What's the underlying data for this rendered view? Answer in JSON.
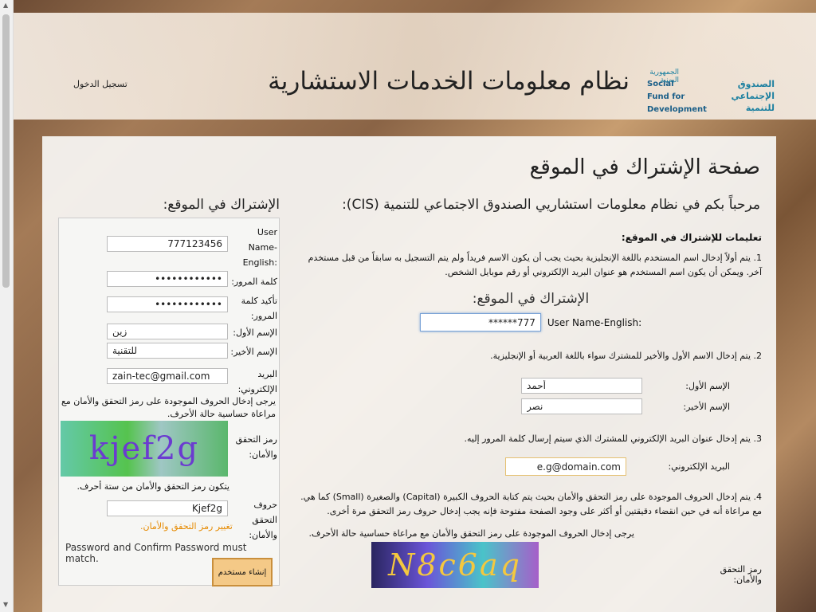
{
  "header": {
    "login_link": "تسجيل الدخول",
    "app_title": "نظام معلومات الخدمات الاستشارية",
    "logo": {
      "emblem_text": "الجمهورية اليمنية",
      "ar_line1": "الصندوق",
      "ar_line2": "الإجتماعي",
      "ar_line3": "للتنمية",
      "en_line1": "Social",
      "en_line2": "Fund for",
      "en_line3": "Development"
    }
  },
  "page": {
    "title": "صفحة الإشتراك في الموقع",
    "welcome": "مرحباً بكم في نظام معلومات استشاريي الصندوق الاجتماعي للتنمية (CIS):"
  },
  "instructions": {
    "title": "تعليمات للإشتراك في الموقع:",
    "step1": "1. يتم أولاً إدخال اسم المستخدم باللغة الإنجليزية بحيث يجب أن يكون الاسم فريداً ولم يتم التسجيل به سابقاً من قبل مستخدم آخر. ويمكن أن يكون اسم المستخدم هو عنوان البريد الإلكتروني أو رقم موبايل الشخص.",
    "sub_heading": "الإشتراك في الموقع:",
    "example_username_label": "User Name-English:",
    "example_username_value": "777******",
    "step2": "2. يتم إدخال الاسم الأول والأخير للمشترك سواء باللغة العربية أو الإنجليزية.",
    "example_first_label": "الإسم الأول:",
    "example_first_value": "أحمد",
    "example_last_label": "الإسم الأخير:",
    "example_last_value": "نصر",
    "step3": "3. يتم إدخال عنوان البريد الإلكتروني للمشترك الذي سيتم إرسال كلمة المرور إليه.",
    "example_email_label": "البريد الإلكتروني:",
    "example_email_value": "e.g@domain.com",
    "step4": "4. يتم إدخال الحروف الموجودة على رمز التحقق والأمان بحيث يتم كتابة الحروف الكبيرة (Capital) والصغيرة (Small) كما هي. مع مراعاة أنه في حين انقضاء دقيقتين أو أكثر على وجود الصفحة مفتوحة فإنه يجب إدخال حروف رمز التحقق مرة أخرى.",
    "captcha_note": "يرجى إدخال الحروف الموجودة على رمز التحقق والأمان مع مراعاة حساسية حالة الأحرف.",
    "captcha_label": "رمز التحقق والأمان:",
    "captcha_text": "N8c6aq"
  },
  "form": {
    "title": "الإشتراك في الموقع:",
    "username_label": "User Name-English:",
    "username_value": "777123456",
    "password_label": "كلمة المرور:",
    "password_value": "••••••••••••",
    "confirm_label": "تأكيد كلمة المرور:",
    "confirm_value": "••••••••••••",
    "first_label": "الإسم الأول:",
    "first_value": "زين",
    "last_label": "الإسم الأخير:",
    "last_value": "للتقنية",
    "email_label": "البريد الإلكتروني:",
    "email_value": "zain-tec@gmail.com",
    "captcha_note": "يرجى إدخال الحروف الموجودة على رمز التحقق والأمان مع مراعاة حساسية حالة الأحرف.",
    "captcha_label": "رمز التحقق والأمان:",
    "captcha_text": "kjef2g",
    "captcha_length_note": "يتكون رمز التحقق والأمان من ستة أحرف.",
    "captcha_input_label": "حروف التحقق والأمان:",
    "captcha_input_value": "Kjef2g",
    "change_captcha": "تغيير رمز التحقق والأمان.",
    "error": "Password and Confirm Password must match.",
    "submit": "إنشاء مستخدم"
  },
  "colors": {
    "accent": "#e68a00",
    "button": "#f4c987",
    "logo_blue": "#1a7fa0"
  }
}
